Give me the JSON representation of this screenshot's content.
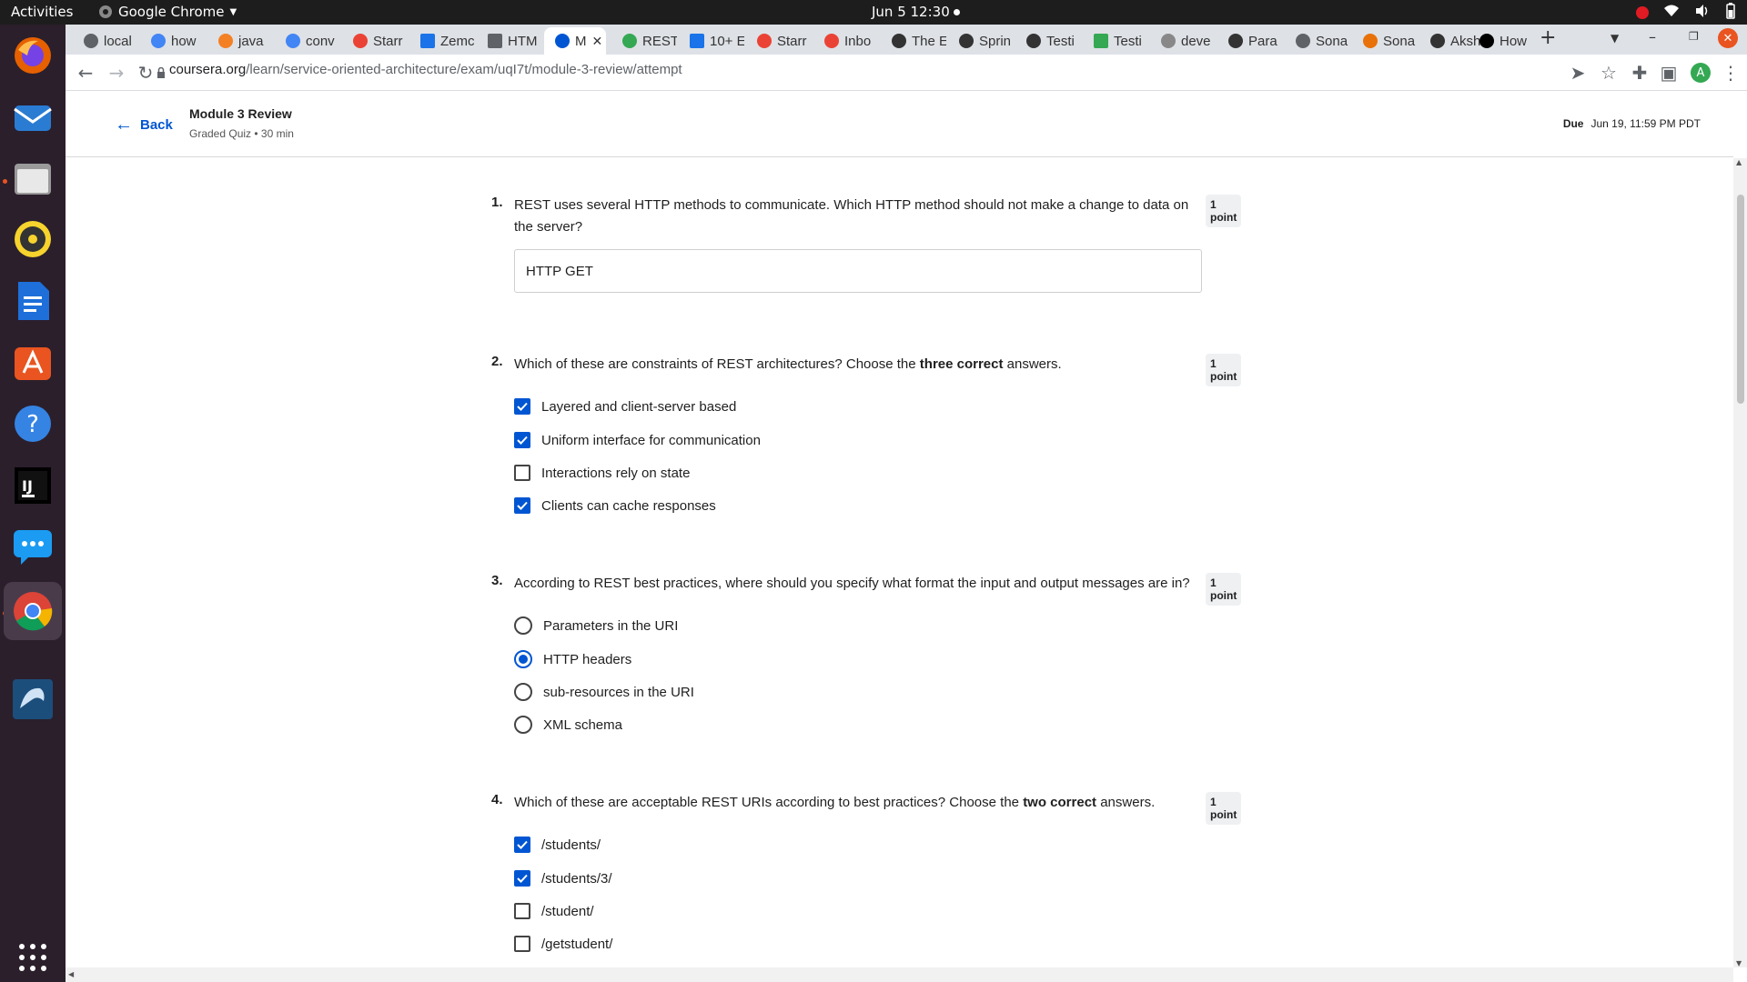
{
  "topbar": {
    "activities": "Activities",
    "app_name": "Google Chrome",
    "clock": "Jun 5  12:30"
  },
  "tabs": [
    {
      "label": "local",
      "color": "#5f6368"
    },
    {
      "label": "how",
      "color": "#4285f4"
    },
    {
      "label": "java",
      "color": "#f48024"
    },
    {
      "label": "conv",
      "color": "#4285f4"
    },
    {
      "label": "Starr",
      "color": "#ea4335"
    },
    {
      "label": "Zemc",
      "color": "#1a73e8"
    },
    {
      "label": "HTM",
      "color": "#5f6368"
    },
    {
      "label": "M",
      "color": "#0056d2",
      "active": true
    },
    {
      "label": "REST",
      "color": "#34a853"
    },
    {
      "label": "10+ E",
      "color": "#1a73e8"
    },
    {
      "label": "Starr",
      "color": "#ea4335"
    },
    {
      "label": "Inbo",
      "color": "#ea4335"
    },
    {
      "label": "The E",
      "color": "#333333"
    },
    {
      "label": "Sprin",
      "color": "#333333"
    },
    {
      "label": "Testi",
      "color": "#333333"
    },
    {
      "label": "Testi",
      "color": "#34a853"
    },
    {
      "label": "deve",
      "color": "#888888"
    },
    {
      "label": "Para",
      "color": "#333333"
    },
    {
      "label": "Sona",
      "color": "#5f6368"
    },
    {
      "label": "Sona",
      "color": "#e8710a"
    },
    {
      "label": "Aksh",
      "color": "#333333"
    },
    {
      "label": "How",
      "color": "#000000"
    }
  ],
  "toolbar": {
    "url_domain": "coursera.org",
    "url_path": "/learn/service-oriented-architecture/exam/uqI7t/module-3-review/attempt",
    "avatar_letter": "A"
  },
  "header": {
    "back_label": "Back",
    "title": "Module 3 Review",
    "subtitle": "Graded Quiz • 30 min",
    "due_label": "Due",
    "due_value": "Jun 19, 11:59 PM PDT"
  },
  "questions": [
    {
      "number": "1.",
      "text": "REST uses several HTTP methods to communicate. Which HTTP method should not make a change to data on the server?",
      "points": "1 point",
      "answer": "HTTP GET"
    },
    {
      "number": "2.",
      "text_before": "Which of these are constraints of REST architectures? Choose the ",
      "text_bold": "three correct",
      "text_after": " answers.",
      "points": "1 point",
      "options": [
        {
          "label": "Layered and client-server based",
          "checked": true
        },
        {
          "label": "Uniform interface for communication",
          "checked": true
        },
        {
          "label": "Interactions rely on state",
          "checked": false
        },
        {
          "label": "Clients can cache responses",
          "checked": true
        }
      ]
    },
    {
      "number": "3.",
      "text": "According to REST best practices, where should you specify what format the input and output messages are in?",
      "points": "1 point",
      "options": [
        {
          "label": "Parameters in the URI",
          "checked": false
        },
        {
          "label": "HTTP headers",
          "checked": true
        },
        {
          "label": "sub-resources in the URI",
          "checked": false
        },
        {
          "label": "XML schema",
          "checked": false
        }
      ]
    },
    {
      "number": "4.",
      "text_before": "Which of these are acceptable REST URIs according to best practices? Choose the ",
      "text_bold": "two correct",
      "text_after": " answers.",
      "points": "1 point",
      "options": [
        {
          "label": "/students/",
          "checked": true
        },
        {
          "label": "/students/3/",
          "checked": true
        },
        {
          "label": "/student/",
          "checked": false
        },
        {
          "label": "/getstudent/",
          "checked": false
        }
      ]
    }
  ]
}
